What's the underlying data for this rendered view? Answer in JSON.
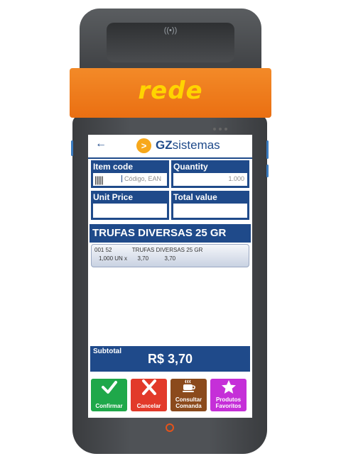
{
  "device": {
    "brand_logo": "rede",
    "nfc_symbol": "((•))"
  },
  "header": {
    "back_icon": "←",
    "logo_mark": ">",
    "logo_gz": "GZ",
    "logo_sistemas": "sistemas"
  },
  "fields": {
    "item_code": {
      "label": "Item code",
      "placeholder": "Código, EAN",
      "barcode_icon": "|||||"
    },
    "quantity": {
      "label": "Quantity",
      "value": "1.000"
    },
    "unit_price": {
      "label": "Unit Price",
      "value": ""
    },
    "total_value": {
      "label": "Total value",
      "value": ""
    }
  },
  "product": {
    "title": "TRUFAS DIVERSAS 25 GR"
  },
  "items": [
    {
      "code": "001 52",
      "description": "TRUFAS DIVERSAS 25 GR",
      "quantity": "1,000 UN x",
      "unit_price": "3,70",
      "total": "3,70"
    }
  ],
  "subtotal": {
    "label": "Subtotal",
    "value": "R$ 3,70"
  },
  "actions": {
    "confirm": {
      "label": "Confirmar",
      "icon": "check-icon",
      "color": "#1fa84a"
    },
    "cancel": {
      "label": "Cancelar",
      "icon": "close-icon",
      "color": "#e23a2a"
    },
    "consult": {
      "label_line1": "Consultar",
      "label_line2": "Comanda",
      "icon": "coffee-icon",
      "color": "#8b4a1c"
    },
    "favorites": {
      "label_line1": "Produtos",
      "label_line2": "Favoritos",
      "icon": "star-icon",
      "color": "#c52fd8"
    }
  }
}
